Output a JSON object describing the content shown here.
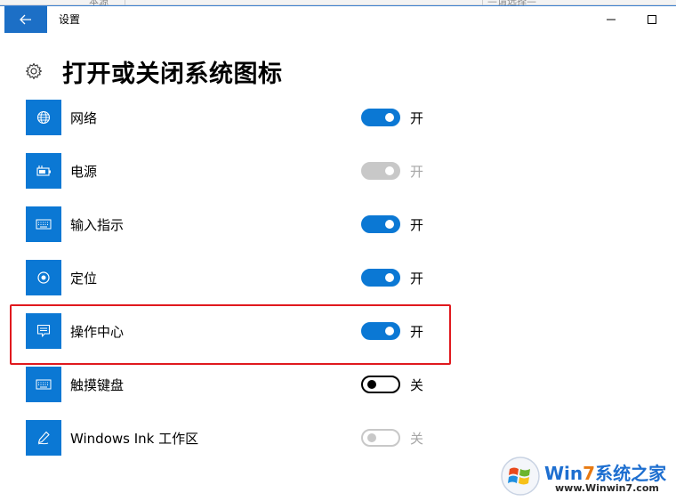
{
  "behind_window": {
    "left_text": "本源",
    "right_text": "—请选择—"
  },
  "titlebar": {
    "title": "设置"
  },
  "page": {
    "title": "打开或关闭系统图标"
  },
  "items": [
    {
      "label": "网络",
      "state": "开",
      "icon": "globe-icon",
      "toggle": "on"
    },
    {
      "label": "电源",
      "state": "开",
      "icon": "battery-icon",
      "toggle": "disabled-on"
    },
    {
      "label": "输入指示",
      "state": "开",
      "icon": "keyboard-icon",
      "toggle": "on"
    },
    {
      "label": "定位",
      "state": "开",
      "icon": "location-icon",
      "toggle": "on"
    },
    {
      "label": "操作中心",
      "state": "开",
      "icon": "action-center-icon",
      "toggle": "on",
      "highlighted": true
    },
    {
      "label": "触摸键盘",
      "state": "关",
      "icon": "keyboard-icon",
      "toggle": "off"
    },
    {
      "label": "Windows Ink 工作区",
      "state": "关",
      "icon": "pen-icon",
      "toggle": "disabled-off"
    }
  ],
  "watermark": {
    "brand_prefix": "Win",
    "brand_num": "7",
    "brand_suffix": "系统之家",
    "url": "www.Winwin7.com"
  },
  "colors": {
    "accent": "#0b78d4",
    "highlight": "#e0191e",
    "disabled": "#c8c8c8"
  }
}
